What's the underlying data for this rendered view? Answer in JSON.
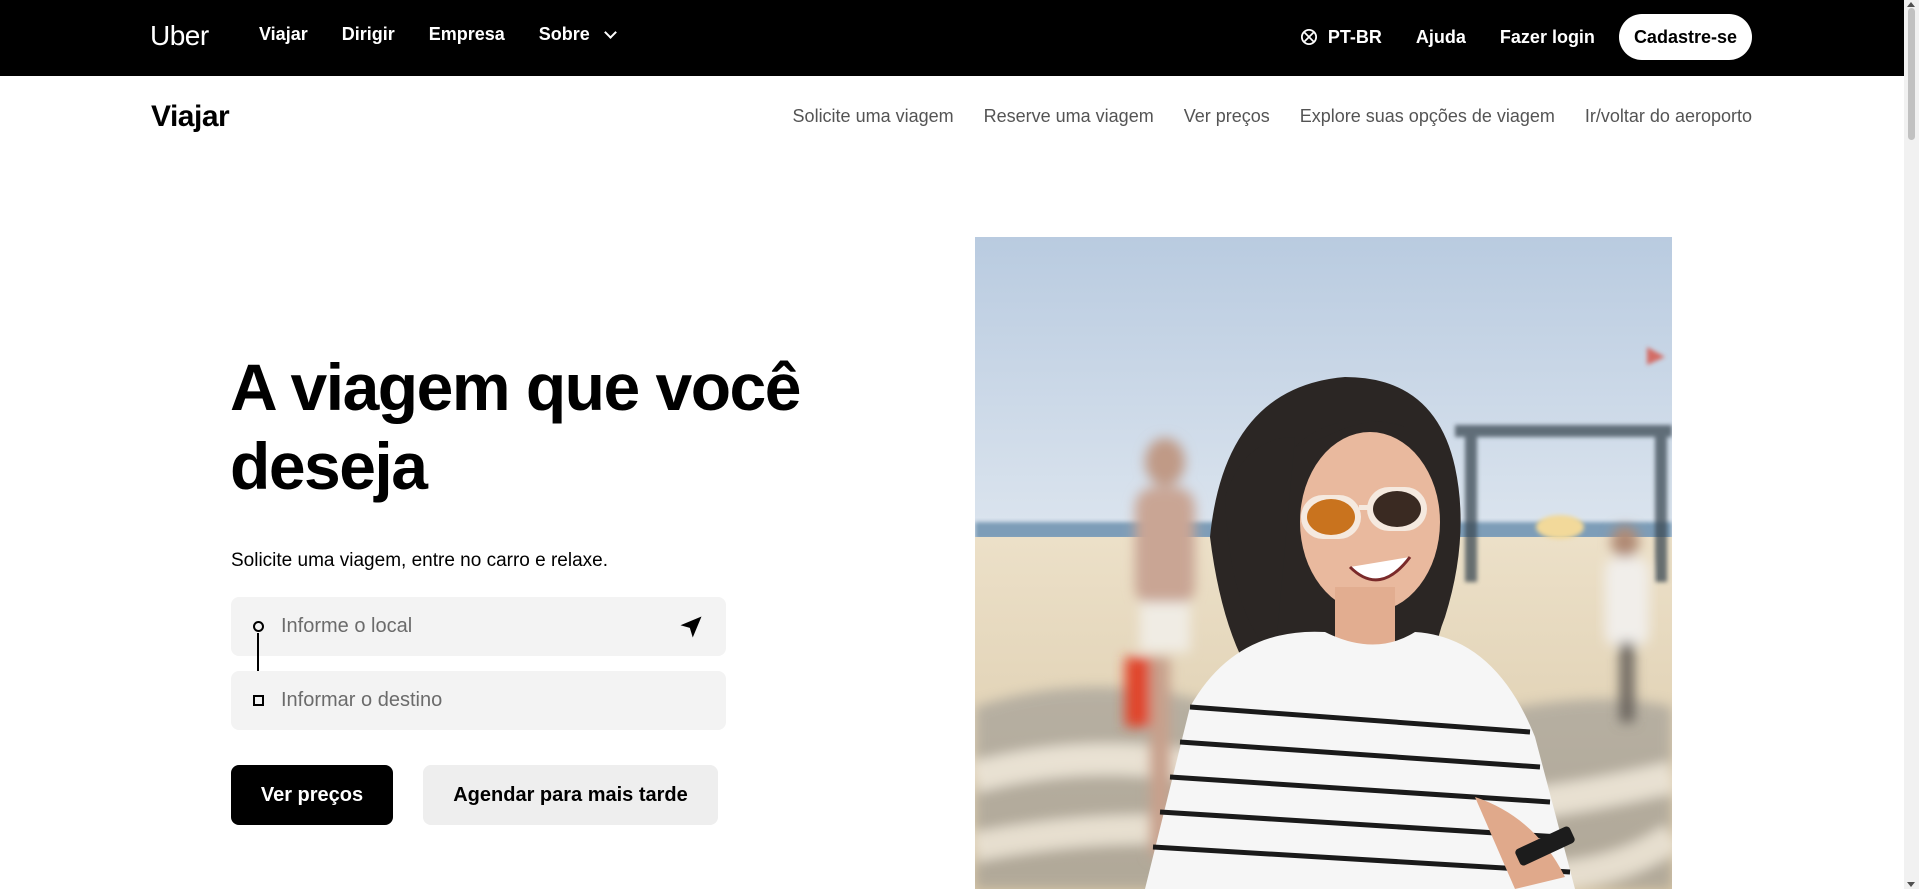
{
  "header": {
    "logo": "Uber",
    "nav": [
      {
        "label": "Viajar"
      },
      {
        "label": "Dirigir"
      },
      {
        "label": "Empresa"
      },
      {
        "label": "Sobre"
      }
    ],
    "language": "PT-BR",
    "help": "Ajuda",
    "login": "Fazer login",
    "signup": "Cadastre-se"
  },
  "subnav": {
    "title": "Viajar",
    "links": [
      {
        "label": "Solicite uma viagem"
      },
      {
        "label": "Reserve uma viagem"
      },
      {
        "label": "Ver preços"
      },
      {
        "label": "Explore suas opções de viagem"
      },
      {
        "label": "Ir/voltar do aeroporto"
      }
    ]
  },
  "hero": {
    "title": "A viagem que você deseja",
    "subtitle": "Solicite uma viagem, entre no carro e relaxe.",
    "pickup_placeholder": "Informe o local",
    "dropoff_placeholder": "Informar o destino",
    "primary_button": "Ver preços",
    "secondary_button": "Agendar para mais tarde"
  },
  "icons": {
    "globe": "globe-icon",
    "chevron": "chevron-down-icon",
    "locate": "navigation-arrow-icon",
    "pickup": "pickup-dot-icon",
    "dropoff": "dropoff-square-icon"
  },
  "colors": {
    "topbar": "#000000",
    "primary_button": "#000000",
    "secondary_button": "#eeeeee",
    "input_background": "#f3f3f3",
    "link_gray": "#545454"
  }
}
